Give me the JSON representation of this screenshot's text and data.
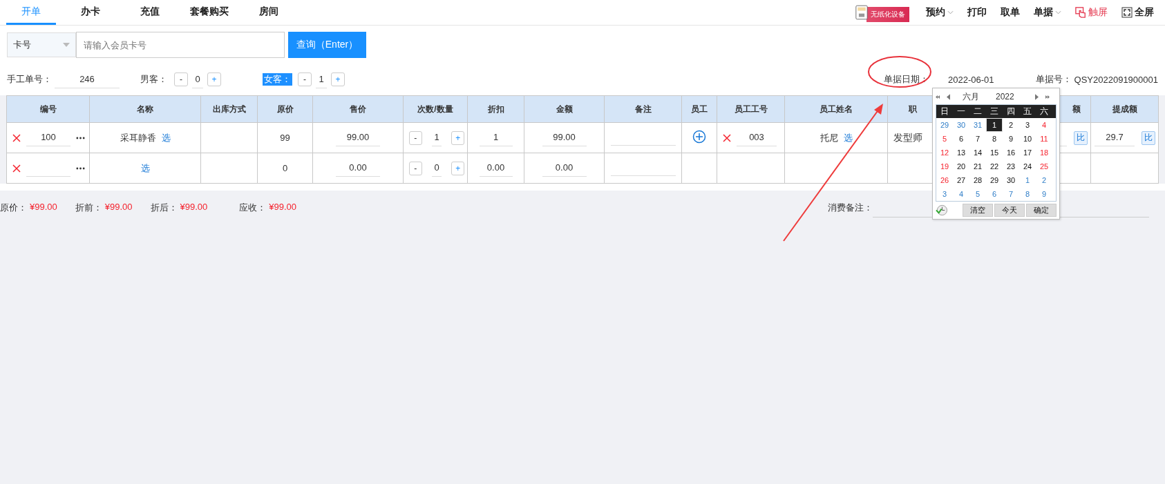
{
  "tabs": [
    {
      "label": "开单",
      "selected": true
    },
    {
      "label": "办卡",
      "selected": false
    },
    {
      "label": "充值",
      "selected": false
    },
    {
      "label": "套餐购买",
      "selected": false
    },
    {
      "label": "房间",
      "selected": false
    }
  ],
  "toolbar": {
    "promo_badge": "无纸化设备",
    "items": [
      {
        "label": "预约",
        "kind": "dropdown"
      },
      {
        "label": "打印",
        "kind": "plain"
      },
      {
        "label": "取单",
        "kind": "plain"
      },
      {
        "label": "单据",
        "kind": "dropdown"
      },
      {
        "label": "触屏",
        "kind": "touch"
      },
      {
        "label": "全屏",
        "kind": "fullscreen"
      }
    ]
  },
  "search": {
    "type_select": "卡号",
    "placeholder": "请输入会员卡号",
    "button": "查询（Enter）"
  },
  "order_info": {
    "manual_no_label": "手工单号：",
    "manual_no": "246",
    "guests": [
      {
        "label": "男客：",
        "count": "0",
        "minus": "-",
        "plus": "+",
        "selected": false
      },
      {
        "label": "女客：",
        "count": "1",
        "minus": "-",
        "plus": "+",
        "selected": true
      }
    ],
    "date_label": "单据日期：",
    "date": "2022-06-01",
    "order_no_label": "单据号：",
    "order_no": "QSY2022091900001"
  },
  "table": {
    "columns": [
      "编号",
      "名称",
      "出库方式",
      "原价",
      "售价",
      "次数/数量",
      "折扣",
      "金额",
      "备注",
      "员工",
      "员工工号",
      "员工姓名",
      "职",
      "额",
      "提成额"
    ],
    "rows": [
      {
        "code": "100",
        "name": "采耳静香",
        "pick": "选",
        "outbound": "",
        "original_price": "99",
        "sale_price": "99.00",
        "qty": "1",
        "minus": "-",
        "plus": "+",
        "discount": "1",
        "amount": "99.00",
        "note": "",
        "staff": {
          "no": "003",
          "name": "托尼",
          "pick": "选",
          "position": "发型师",
          "ratio_button": "比",
          "commission": "29.7",
          "commission_button": "比"
        }
      },
      {
        "code": "",
        "name": "",
        "pick": "选",
        "outbound": "",
        "original_price": "0",
        "sale_price": "0.00",
        "qty": "0",
        "minus": "-",
        "plus": "+",
        "discount": "0.00",
        "amount": "0.00",
        "note": "",
        "staff": null
      }
    ]
  },
  "totals": [
    {
      "label": "原价：",
      "value": "¥99.00"
    },
    {
      "label": "折前：",
      "value": "¥99.00"
    },
    {
      "label": "折后：",
      "value": "¥99.00"
    },
    {
      "label": "应收：",
      "value": "¥99.00"
    }
  ],
  "remark_label": "消费备注：",
  "calendar": {
    "month": "六月",
    "year": "2022",
    "weekdays": [
      "日",
      "一",
      "二",
      "三",
      "四",
      "五",
      "六"
    ],
    "weeks": [
      [
        {
          "day": "29",
          "kind": "adjacent",
          "selected": false
        },
        {
          "day": "30",
          "kind": "adjacent",
          "selected": false
        },
        {
          "day": "31",
          "kind": "adjacent",
          "selected": false
        },
        {
          "day": "1",
          "kind": "weekday",
          "selected": true
        },
        {
          "day": "2",
          "kind": "weekday",
          "selected": false
        },
        {
          "day": "3",
          "kind": "weekday",
          "selected": false
        },
        {
          "day": "4",
          "kind": "weekend",
          "selected": false
        }
      ],
      [
        {
          "day": "5",
          "kind": "weekend",
          "selected": false
        },
        {
          "day": "6",
          "kind": "weekday",
          "selected": false
        },
        {
          "day": "7",
          "kind": "weekday",
          "selected": false
        },
        {
          "day": "8",
          "kind": "weekday",
          "selected": false
        },
        {
          "day": "9",
          "kind": "weekday",
          "selected": false
        },
        {
          "day": "10",
          "kind": "weekday",
          "selected": false
        },
        {
          "day": "11",
          "kind": "weekend",
          "selected": false
        }
      ],
      [
        {
          "day": "12",
          "kind": "weekend",
          "selected": false
        },
        {
          "day": "13",
          "kind": "weekday",
          "selected": false
        },
        {
          "day": "14",
          "kind": "weekday",
          "selected": false
        },
        {
          "day": "15",
          "kind": "weekday",
          "selected": false
        },
        {
          "day": "16",
          "kind": "weekday",
          "selected": false
        },
        {
          "day": "17",
          "kind": "weekday",
          "selected": false
        },
        {
          "day": "18",
          "kind": "weekend",
          "selected": false
        }
      ],
      [
        {
          "day": "19",
          "kind": "weekend",
          "selected": false
        },
        {
          "day": "20",
          "kind": "weekday",
          "selected": false
        },
        {
          "day": "21",
          "kind": "weekday",
          "selected": false
        },
        {
          "day": "22",
          "kind": "weekday",
          "selected": false
        },
        {
          "day": "23",
          "kind": "weekday",
          "selected": false
        },
        {
          "day": "24",
          "kind": "weekday",
          "selected": false
        },
        {
          "day": "25",
          "kind": "weekend",
          "selected": false
        }
      ],
      [
        {
          "day": "26",
          "kind": "weekend",
          "selected": false
        },
        {
          "day": "27",
          "kind": "weekday",
          "selected": false
        },
        {
          "day": "28",
          "kind": "weekday",
          "selected": false
        },
        {
          "day": "29",
          "kind": "weekday",
          "selected": false
        },
        {
          "day": "30",
          "kind": "weekday",
          "selected": false
        },
        {
          "day": "1",
          "kind": "adjacent",
          "selected": false
        },
        {
          "day": "2",
          "kind": "adjacent",
          "selected": false
        }
      ],
      [
        {
          "day": "3",
          "kind": "adjacent",
          "selected": false
        },
        {
          "day": "4",
          "kind": "adjacent",
          "selected": false
        },
        {
          "day": "5",
          "kind": "adjacent",
          "selected": false
        },
        {
          "day": "6",
          "kind": "adjacent",
          "selected": false
        },
        {
          "day": "7",
          "kind": "adjacent",
          "selected": false
        },
        {
          "day": "8",
          "kind": "adjacent",
          "selected": false
        },
        {
          "day": "9",
          "kind": "adjacent",
          "selected": false
        }
      ]
    ],
    "buttons": [
      "清空",
      "今天",
      "确定"
    ]
  }
}
